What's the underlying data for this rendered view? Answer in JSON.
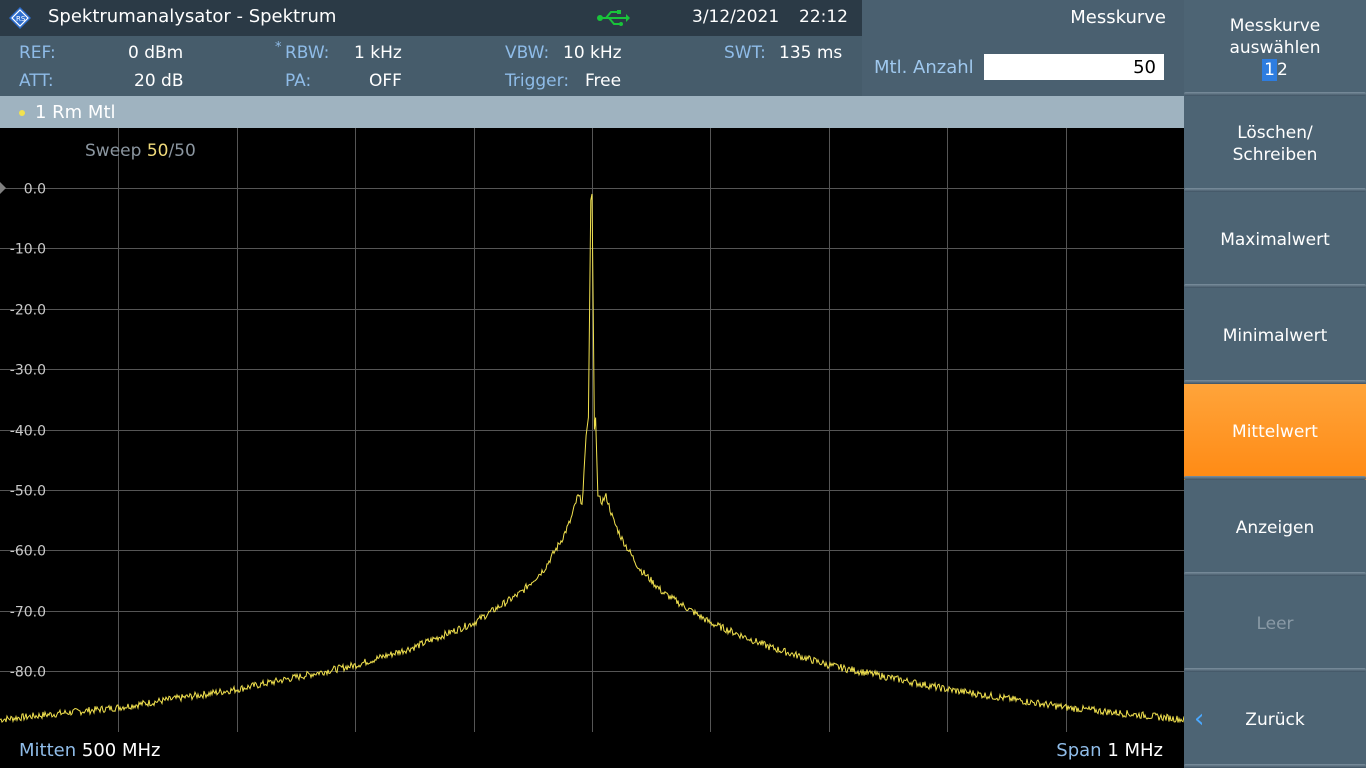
{
  "header": {
    "app_title": "Spektrumanalysator - Spektrum",
    "date": "3/12/2021",
    "time": "22:12",
    "menu_title": "Messkurve",
    "avg_label": "Mtl. Anzahl",
    "avg_value": "50",
    "icons": {
      "logo": "rs-logo-icon",
      "usb": "usb-icon"
    },
    "usb_color": "#19c43a"
  },
  "params": {
    "ref_label": "REF:",
    "ref_value": "0 dBm",
    "att_label": "ATT:",
    "att_value": "20 dB",
    "rbw_marker": "*",
    "rbw_label": "RBW:",
    "rbw_value": "1 kHz",
    "pa_label": "PA:",
    "pa_value": "OFF",
    "vbw_label": "VBW:",
    "vbw_value": "10 kHz",
    "trigger_label": "Trigger:",
    "trigger_value": "Free",
    "swt_label": "SWT:",
    "swt_value": "135 ms"
  },
  "trace": {
    "label": "1 Rm  Mtl",
    "sweep_current": "50",
    "sweep_total": "/50",
    "sweep_prefix": "Sweep ",
    "color": "#f2e24f"
  },
  "footer": {
    "center_label": "Mitten",
    "center_value": "500 MHz",
    "span_label": "Span",
    "span_value": "1 MHz"
  },
  "softkeys": {
    "select_line1": "Messkurve",
    "select_line2": "auswählen",
    "select_opt1": "1",
    "select_opt2": "2",
    "clear_write_line1": "Löschen/",
    "clear_write_line2": "Schreiben",
    "max": "Maximalwert",
    "min": "Minimalwert",
    "avg": "Mittelwert",
    "view": "Anzeigen",
    "blank": "Leer",
    "back": "Zurück",
    "active_color": "#ff9a28"
  },
  "chart_data": {
    "type": "line",
    "ylabel": "",
    "yticks": [
      "0.0",
      "-10.0",
      "-20.0",
      "-30.0",
      "-40.0",
      "-50.0",
      "-60.0",
      "-70.0",
      "-80.0"
    ],
    "ylim": [
      -88,
      10
    ],
    "xlim": [
      -500,
      500
    ],
    "x_unit": "kHz offset",
    "grid": true,
    "series": [
      {
        "color": "#f2e24f",
        "x": [
          -500,
          -400,
          -300,
          -200,
          -150,
          -100,
          -60,
          -40,
          -25,
          -18,
          -12,
          -8,
          -5,
          -3,
          -2,
          -1,
          0,
          1,
          2,
          3,
          5,
          8,
          12,
          18,
          25,
          40,
          60,
          100,
          150,
          200,
          300,
          400,
          500
        ],
        "y": [
          -88,
          -86,
          -83,
          -79,
          -76,
          -72,
          -67,
          -63,
          -58,
          -55,
          -51,
          -52,
          -41,
          -38,
          -20,
          -2,
          -1,
          -20,
          -40,
          -38,
          -51,
          -52,
          -51,
          -55,
          -58,
          -63,
          -67,
          -72,
          -76,
          -79,
          -83,
          -86,
          -88
        ]
      }
    ]
  }
}
